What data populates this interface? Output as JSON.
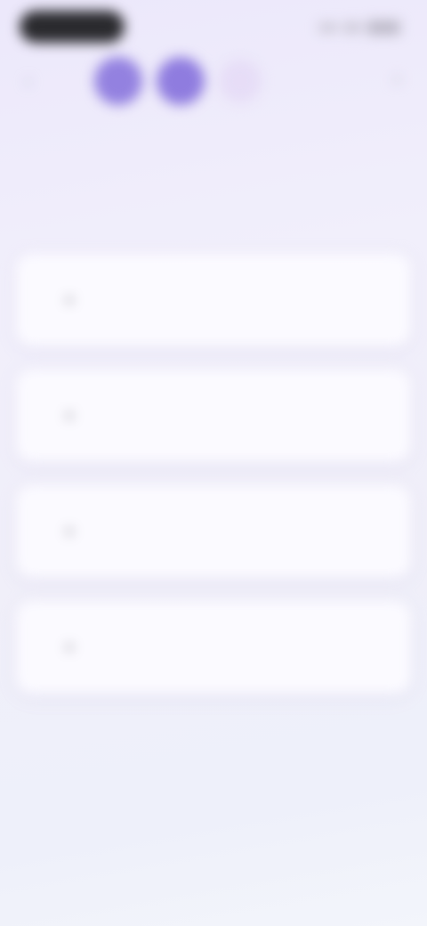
{
  "status_bar": {
    "icons": [
      "signal-icon",
      "wifi-icon",
      "battery-icon"
    ]
  },
  "header": {
    "back_icon": "chevron-left-icon",
    "close_icon": "close-icon",
    "progress_steps": [
      "completed",
      "completed",
      "pending"
    ]
  },
  "question": {
    "title": ""
  },
  "options": [
    {
      "label": "",
      "icon": "option-icon"
    },
    {
      "label": "",
      "icon": "option-icon"
    },
    {
      "label": "",
      "icon": "option-icon"
    },
    {
      "label": "",
      "icon": "option-icon"
    }
  ],
  "colors": {
    "accent": "#8f7cdf",
    "accent_light": "#e6dcf6",
    "card": "#fbfaff",
    "background": "#efedfa"
  }
}
